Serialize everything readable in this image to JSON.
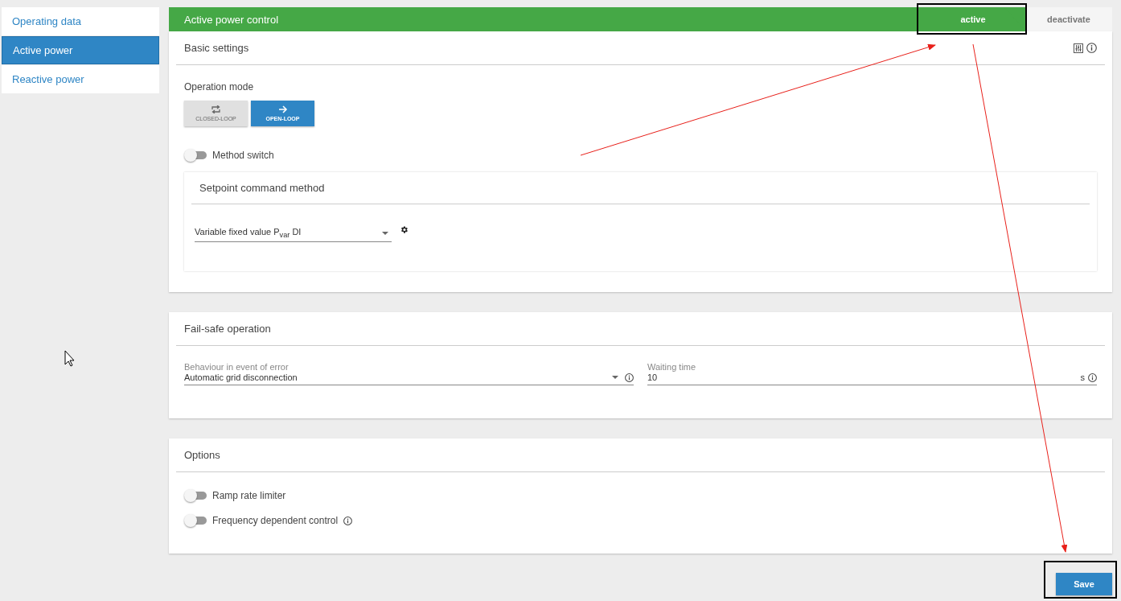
{
  "sidebar": {
    "items": [
      {
        "label": "Operating data",
        "selected": false
      },
      {
        "label": "Active power",
        "selected": true
      },
      {
        "label": "Reactive power",
        "selected": false
      }
    ]
  },
  "header": {
    "title": "Active power control",
    "status_buttons": [
      {
        "label": "active",
        "selected": true
      },
      {
        "label": "deactivate",
        "selected": false
      }
    ]
  },
  "basic_settings": {
    "title": "Basic settings",
    "operation_mode": {
      "label": "Operation mode",
      "options": [
        {
          "label": "CLOSED-LOOP",
          "kind": "loop",
          "selected": false
        },
        {
          "label": "OPEN-LOOP",
          "kind": "arrow",
          "selected": true
        }
      ]
    },
    "method_switch": {
      "label": "Method switch",
      "on": false
    },
    "setpoint": {
      "title": "Setpoint command method",
      "value": "Variable fixed value P$_{var}$ DI"
    }
  },
  "fail_safe": {
    "title": "Fail-safe operation",
    "behaviour": {
      "label": "Behaviour in event of error",
      "value": "Automatic grid disconnection"
    },
    "waiting_time": {
      "label": "Waiting time",
      "value": "10",
      "unit": "s"
    }
  },
  "options": {
    "title": "Options",
    "toggles": [
      {
        "label": "Ramp rate limiter",
        "on": false,
        "info": false
      },
      {
        "label": "Frequency dependent control",
        "on": false,
        "info": true
      }
    ]
  },
  "save_button": "Save"
}
